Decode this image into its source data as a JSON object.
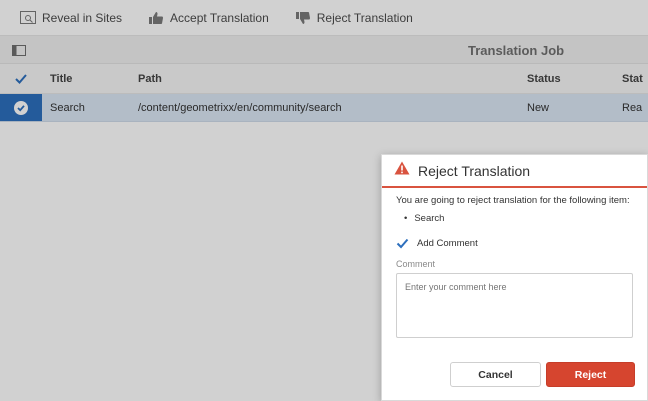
{
  "toolbar": {
    "reveal_label": "Reveal in Sites",
    "accept_label": "Accept Translation",
    "reject_label": "Reject Translation"
  },
  "header": {
    "title": "Translation Job"
  },
  "table": {
    "columns": [
      "Title",
      "Path",
      "Status",
      "Stat"
    ],
    "rows": [
      {
        "title": "Search",
        "path": "/content/geometrixx/en/community/search",
        "status": "New",
        "status2": "Rea"
      }
    ]
  },
  "dialog": {
    "title": "Reject Translation",
    "message": "You are going to reject translation for the following item:",
    "items": [
      "Search"
    ],
    "add_comment_label": "Add Comment",
    "add_comment_checked": true,
    "comment_label": "Comment",
    "comment_placeholder": "Enter your comment here",
    "cancel_label": "Cancel",
    "reject_label": "Reject"
  },
  "colors": {
    "accent_blue": "#2d6fbd",
    "reject_red": "#d6452f",
    "warning_red": "#d9533f"
  },
  "icons": {
    "reveal": "reveal-in-sites-icon",
    "accept": "thumbs-up-icon",
    "reject": "thumbs-down-icon",
    "rail": "rail-toggle-icon",
    "warning": "alert-icon"
  }
}
